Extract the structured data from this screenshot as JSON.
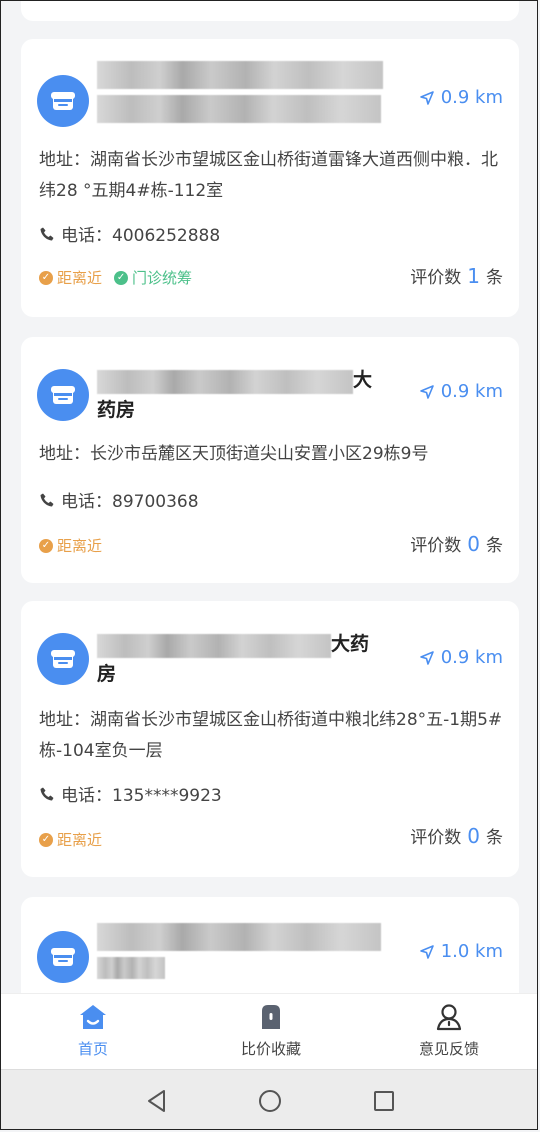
{
  "stores": [
    {
      "name_suffix": "",
      "distance": "0.9 km",
      "address": "地址：湖南省长沙市望城区金山桥街道雷锋大道西侧中粮．北纬28 °五期4#栋-112室",
      "phone": "电话：4006252888",
      "tags": [
        "距离近",
        "门诊统筹"
      ],
      "rating_label": "评价数",
      "rating_count": "1",
      "rating_unit": "条"
    },
    {
      "name_suffix": "大",
      "name_line2": "药房",
      "distance": "0.9 km",
      "address": "地址：长沙市岳麓区天顶街道尖山安置小区29栋9号",
      "phone": "电话：89700368",
      "tags": [
        "距离近"
      ],
      "rating_label": "评价数",
      "rating_count": "0",
      "rating_unit": "条"
    },
    {
      "name_suffix": "大药",
      "name_line2": "房",
      "distance": "0.9 km",
      "address": "地址：湖南省长沙市望城区金山桥街道中粮北纬28°五-1期5#栋-104室负一层",
      "phone": "电话：135****9923",
      "tags": [
        "距离近"
      ],
      "rating_label": "评价数",
      "rating_count": "0",
      "rating_unit": "条"
    },
    {
      "name_suffix": "",
      "distance": "1.0 km"
    }
  ],
  "tabbar": {
    "home": "首页",
    "favorites": "比价收藏",
    "feedback": "意见反馈"
  },
  "colors": {
    "accent": "#4a8ef0",
    "near_tag": "#e8a04a",
    "clinic_tag": "#4cc08a"
  }
}
